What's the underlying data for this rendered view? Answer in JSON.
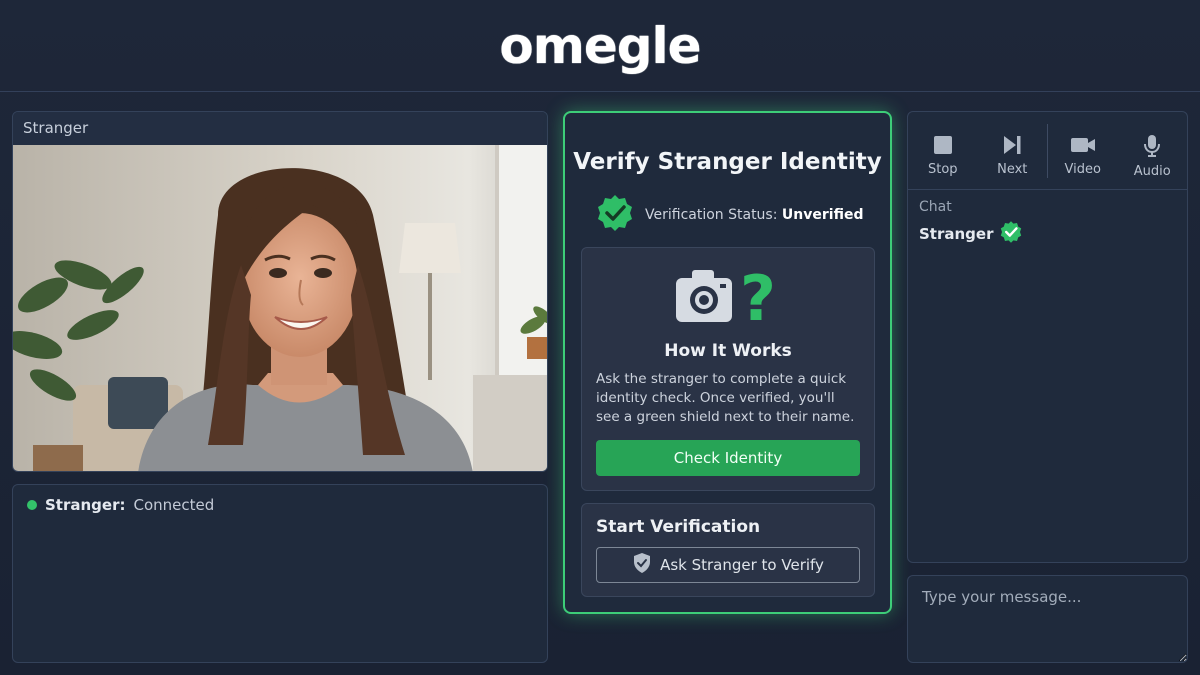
{
  "header": {
    "logo": "omegle"
  },
  "video": {
    "label": "Stranger"
  },
  "status": {
    "name": "Stranger:",
    "value": "Connected",
    "color": "#33c26a"
  },
  "verify": {
    "title": "Verify Stranger Identity",
    "status_label": "Verification Status:",
    "status_value": "Unverified",
    "how_title": "How It Works",
    "how_text": "Ask the stranger to complete a quick identity check. Once verified, you'll see a green shield next to their name.",
    "check_button": "Check Identity",
    "start_title": "Start Verification",
    "ask_button": "Ask Stranger to Verify",
    "accent": "#3dcd78"
  },
  "controls": [
    {
      "label": "Stop",
      "icon": "stop-icon"
    },
    {
      "label": "Next",
      "icon": "next-icon"
    },
    {
      "label": "Video",
      "icon": "video-camera-icon"
    },
    {
      "label": "Audio",
      "icon": "microphone-icon"
    }
  ],
  "chat": {
    "label": "Chat",
    "name": "Stranger"
  },
  "input": {
    "placeholder": "Type your message..."
  }
}
